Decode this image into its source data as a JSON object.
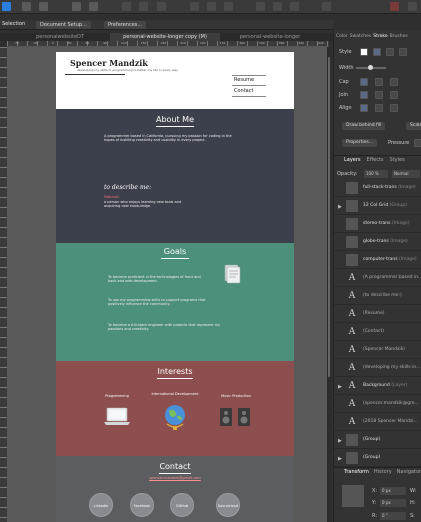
{
  "toolbar": {
    "context_label": "Selection",
    "document_setup": "Document Setup...",
    "preferences": "Preferences..."
  },
  "tabs": [
    {
      "label": "personalwebsiteDT"
    },
    {
      "label": "personal-website-longer copy (M)"
    },
    {
      "label": "personal-website-longer"
    }
  ],
  "ruler": {
    "marks": [
      "-70",
      "-30",
      "0",
      "30",
      "60",
      "90",
      "120",
      "150",
      "180",
      "210",
      "240",
      "270",
      "300",
      "330",
      "360",
      "390",
      "420"
    ]
  },
  "site": {
    "name": "Spencer Mandzik",
    "tagline": "developing my skills in programming to better my life in every way",
    "nav": {
      "resume": "Resume",
      "contact": "Contact"
    },
    "about": {
      "title": "About Me",
      "text": "A programmer based in California, pursuing my passion for coding in the hopes of instilling creativity and usability in every project.",
      "subhead": "to describe me:",
      "tag": "Fabricati",
      "subtext": "a person who enjoys learning new tools and acquiring new know-ledge."
    },
    "goals": {
      "title": "Goals",
      "items": [
        "To become proficient in the technologies of front and back-end web development.",
        "To use my programming skills to support programs that positively influence the community.",
        "To become a full-stack engineer with projects that represent my passions and creativity."
      ]
    },
    "interests": {
      "title": "Interests",
      "items": [
        {
          "label": "Programming"
        },
        {
          "label": "International Development"
        },
        {
          "label": "Music Production"
        }
      ]
    },
    "contact": {
      "title": "Contact",
      "email": "spencer.mandzik@gmail.com",
      "socials": [
        "LinkedIn",
        "Facebook",
        "GitHub",
        "Soundcloud"
      ]
    }
  },
  "panel": {
    "tabs": [
      {
        "label": "Color"
      },
      {
        "label": "Swatches"
      },
      {
        "label": "Stroke"
      },
      {
        "label": "Brushes"
      }
    ],
    "style_label": "Style",
    "width_label": "Width",
    "cap_label": "Cap",
    "join_label": "Join",
    "align_label": "Align",
    "draw_behind": "Draw behind fill",
    "scale_label": "Scale",
    "properties": "Properties...",
    "pressure": "Pressure",
    "layers_tabs": [
      {
        "label": "Layers"
      },
      {
        "label": "Effects"
      },
      {
        "label": "Styles"
      }
    ],
    "opacity_label": "Opacity:",
    "opacity_value": "100 %",
    "blend_value": "Normal",
    "layers": [
      {
        "name": "full-stack-trans",
        "type": "(Image)",
        "kind": "image"
      },
      {
        "name": "12 Col Grid",
        "type": "(Group)",
        "kind": "image",
        "expand": true
      },
      {
        "name": "stereo-trans",
        "type": "(Image)",
        "kind": "image"
      },
      {
        "name": "globe-trans",
        "type": "(Image)",
        "kind": "image"
      },
      {
        "name": "computer-trans",
        "type": "(Image)",
        "kind": "image"
      },
      {
        "name": "(A programmer based in...",
        "type": "",
        "kind": "text"
      },
      {
        "name": "(to describe me:)",
        "type": "",
        "kind": "text"
      },
      {
        "name": "(Resume)",
        "type": "",
        "kind": "text"
      },
      {
        "name": "(Contact)",
        "type": "",
        "kind": "text"
      },
      {
        "name": "(Spencer Mandzik)",
        "type": "",
        "kind": "text"
      },
      {
        "name": "(developing my skills in...",
        "type": "",
        "kind": "text"
      },
      {
        "name": "Background",
        "type": "(Layer)",
        "kind": "text",
        "expand": true
      },
      {
        "name": "(spencer.mandzik@gm...",
        "type": "",
        "kind": "text"
      },
      {
        "name": "(2018 Spencer Mandzi...",
        "type": "",
        "kind": "text"
      },
      {
        "name": "(Group)",
        "type": "",
        "kind": "image",
        "expand": true
      },
      {
        "name": "(Group)",
        "type": "",
        "kind": "image",
        "expand": true
      }
    ],
    "bottom_tabs": [
      {
        "label": "Transform"
      },
      {
        "label": "History"
      },
      {
        "label": "Navigator"
      }
    ],
    "transform": {
      "x_label": "X:",
      "x_value": "0 px",
      "y_label": "Y:",
      "y_value": "0 px",
      "r_label": "R:",
      "r_value": "0 °",
      "w_label": "W:",
      "h_label": "H:",
      "s_label": "S:"
    }
  }
}
